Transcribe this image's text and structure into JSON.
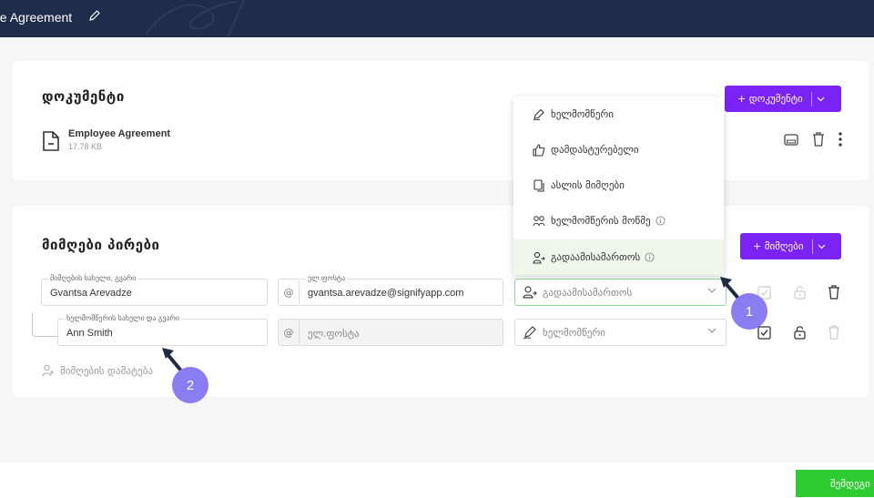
{
  "header": {
    "title": "ee Agreement"
  },
  "documents": {
    "section_title": "დოკუმენტი",
    "add_button": "+ დოკუმენტი",
    "file": {
      "name": "Employee Agreement",
      "size": "17.78 KB"
    }
  },
  "recipients": {
    "section_title": "მიმღები პირები",
    "add_button": "+ მიმღები",
    "rows": [
      {
        "name_label": "მიმღების სახელი, გვარი",
        "name_value": "Gvantsa Arevadze",
        "at": "@",
        "email_label": "ელ.ფოსტა",
        "email_value": "gvantsa.arevadze@signifyapp.com",
        "role_value": "გადაამისამართოს"
      },
      {
        "name_label": "ხელმომწერის სახელი და გვარი",
        "name_value": "Ann Smith",
        "at": "@",
        "email_placeholder": "ელ.ფოსტა",
        "role_value": "ხელმომწერი"
      }
    ],
    "add_recipient": "მიმღების დამატება"
  },
  "role_dropdown": {
    "items": [
      {
        "label": "ხელმომწერი",
        "icon": "pen-icon"
      },
      {
        "label": "დამდასტურებელი",
        "icon": "thumbs-up-icon"
      },
      {
        "label": "ასლის მიმღები",
        "icon": "copy-icon"
      },
      {
        "label": "ხელმომწერის მოწმე",
        "icon": "witness-icon"
      },
      {
        "label": "გადაამისამართოს",
        "icon": "forward-user-icon"
      }
    ],
    "highlighted": "გადაამისამართოს"
  },
  "annotations": {
    "badge1": "1",
    "badge2": "2"
  },
  "footer": {
    "save_label": "შემდეგი"
  },
  "colors": {
    "topbar": "#1f2c4a",
    "accent": "#7b22f5",
    "success": "#2ecc32",
    "badge": "#8a7df2"
  }
}
